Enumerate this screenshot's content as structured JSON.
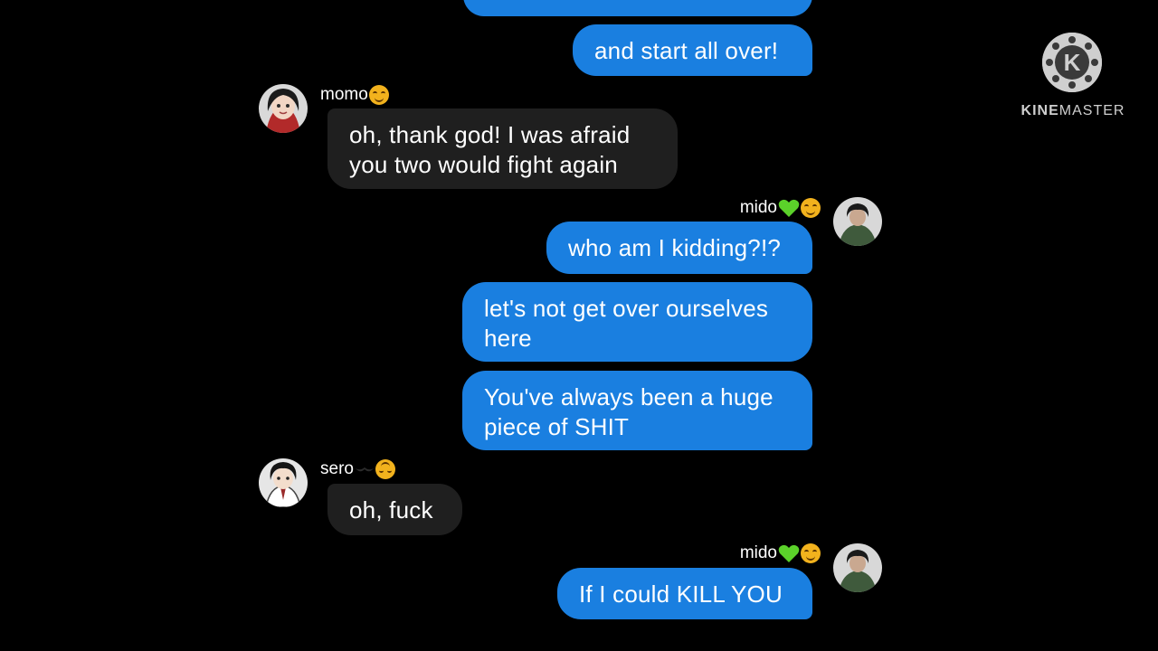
{
  "watermark": {
    "brand_part1": "KINE",
    "brand_part2": "MASTER",
    "badge_letter": "K"
  },
  "messages": [
    {
      "text": "and start all over!"
    },
    {
      "sender": "momo",
      "text": "oh, thank god! I was afraid\nyou two would fight again"
    },
    {
      "sender": "mido",
      "text": "who am I kidding?!?"
    },
    {
      "text": "let's not get over ourselves\nhere"
    },
    {
      "text": "You've always been a huge\npiece of SHIT"
    },
    {
      "sender": "sero",
      "text": "oh, fuck"
    },
    {
      "sender": "mido",
      "text": "If I could KILL YOU"
    }
  ],
  "colors": {
    "outgoing": "#1a7fe0",
    "incoming": "#1f1f1f",
    "background": "#000000"
  }
}
